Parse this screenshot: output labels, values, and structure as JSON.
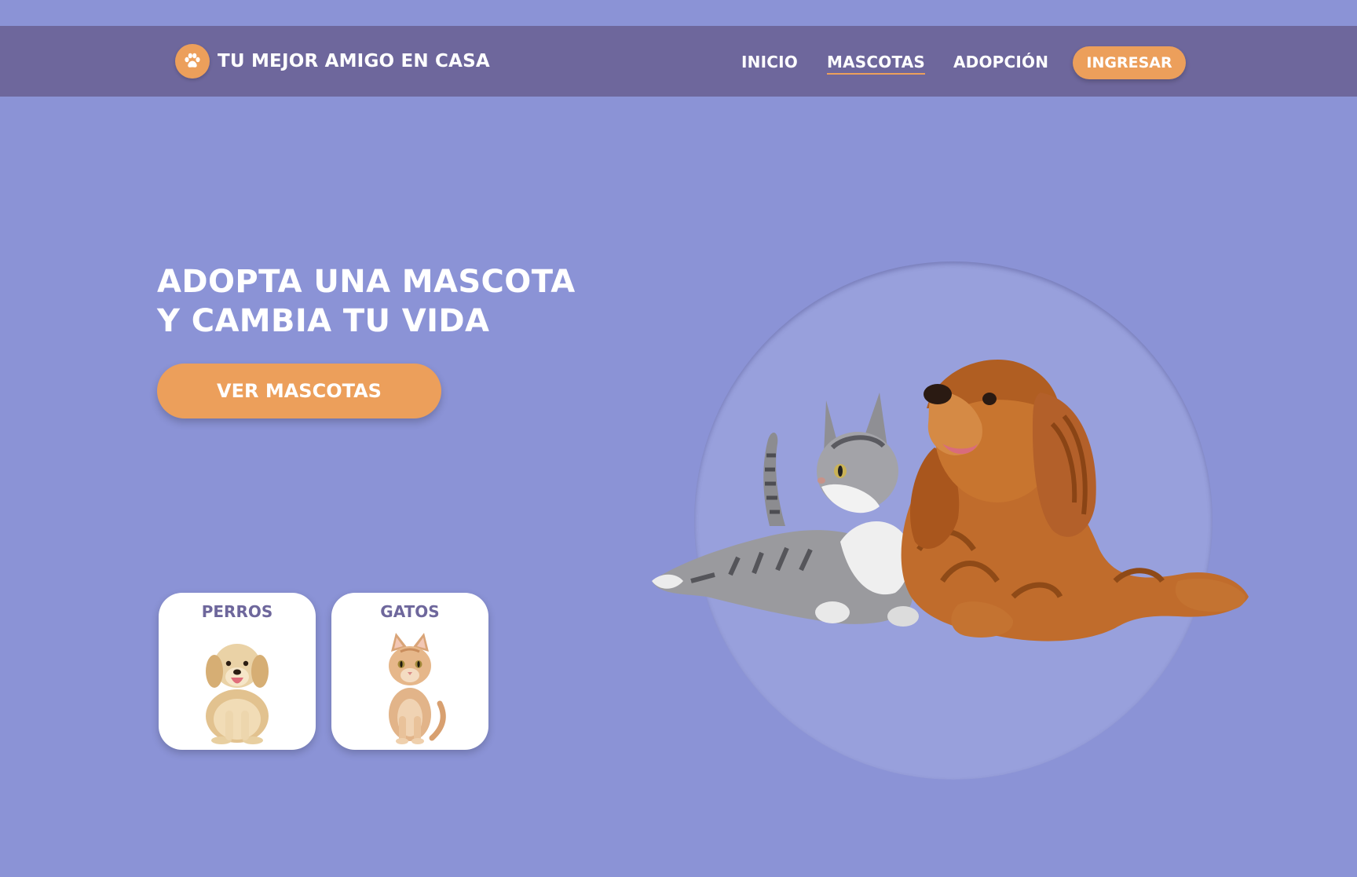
{
  "header": {
    "brand": {
      "logo_icon": "paw-icon",
      "title": "TU MEJOR AMIGO EN CASA"
    },
    "nav": {
      "items": [
        {
          "label": "INICIO",
          "active": false
        },
        {
          "label": "MASCOTAS",
          "active": true
        },
        {
          "label": "ADOPCIÓN",
          "active": false
        }
      ],
      "login_label": "INGRESAR"
    }
  },
  "hero": {
    "title_line1": "ADOPTA UNA MASCOTA",
    "title_line2": "Y CAMBIA TU VIDA",
    "cta_label": "VER MASCOTAS",
    "image": "cat-and-dog-image"
  },
  "categories": [
    {
      "label": "PERROS",
      "image": "puppy-image"
    },
    {
      "label": "GATOS",
      "image": "kitten-image"
    }
  ],
  "colors": {
    "background": "#8b93d6",
    "navbar": "#6e679c",
    "accent": "#ec9f5b",
    "circle": "#98a0dc",
    "text_light": "#ffffff",
    "card_label": "#6e679c"
  }
}
